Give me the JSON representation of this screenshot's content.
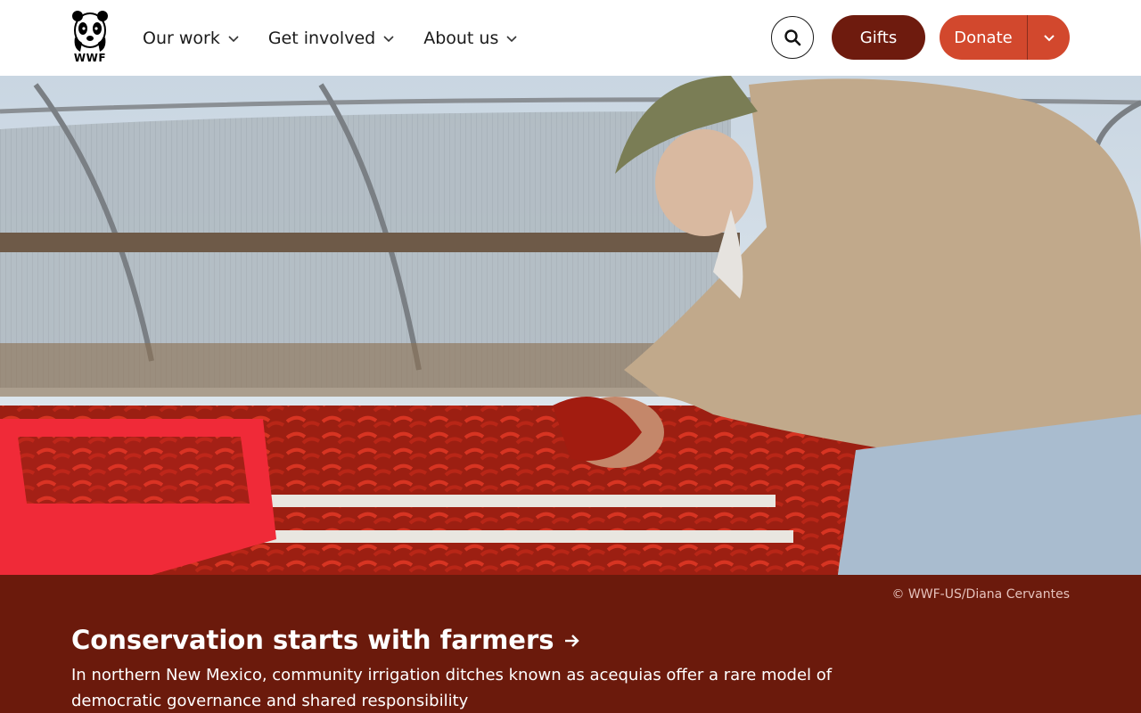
{
  "colors": {
    "brand_dark": "#6e1b0e",
    "donate_orange": "#d2482d",
    "banner_bg": "#6b1a0c",
    "text_dark": "#1a1a1a"
  },
  "header": {
    "logo_text": "WWF",
    "nav": [
      {
        "label": "Our work",
        "icon": "chevron-down-icon"
      },
      {
        "label": "Get involved",
        "icon": "chevron-down-icon"
      },
      {
        "label": "About us",
        "icon": "chevron-down-icon"
      }
    ],
    "search_icon": "search-icon",
    "gifts_label": "Gifts",
    "donate_label": "Donate",
    "donate_toggle_icon": "chevron-down-icon"
  },
  "hero": {
    "image_subject": "farmer sorting dried red chile peppers in a greenhouse",
    "credit": "© WWF-US/Diana Cervantes"
  },
  "feature": {
    "headline": "Conservation starts with farmers",
    "headline_icon": "arrow-right-icon",
    "description": "In northern New Mexico, community irrigation ditches known as acequias offer a rare model of democratic governance and shared responsibility"
  }
}
